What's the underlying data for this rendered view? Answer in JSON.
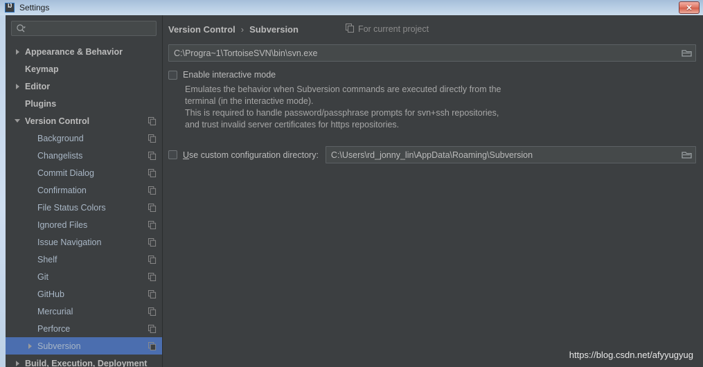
{
  "window": {
    "title": "Settings",
    "app_icon": "intellij-idea-icon",
    "close_label": "✕",
    "accent_selection": "#4b6eaf",
    "background": "#3c3f41",
    "titlebar_color": "#b7cde4"
  },
  "sidebar": {
    "search": {
      "placeholder": "",
      "value": "",
      "icon": "search-icon"
    },
    "items": [
      {
        "label": "Appearance & Behavior",
        "level": 0,
        "arrow": "right",
        "bold": true,
        "project_icon": false,
        "selected": false
      },
      {
        "label": "Keymap",
        "level": 0,
        "arrow": "none",
        "bold": true,
        "project_icon": false,
        "selected": false
      },
      {
        "label": "Editor",
        "level": 0,
        "arrow": "right",
        "bold": true,
        "project_icon": false,
        "selected": false
      },
      {
        "label": "Plugins",
        "level": 0,
        "arrow": "none",
        "bold": true,
        "project_icon": false,
        "selected": false
      },
      {
        "label": "Version Control",
        "level": 0,
        "arrow": "down",
        "bold": true,
        "project_icon": true,
        "selected": false
      },
      {
        "label": "Background",
        "level": 1,
        "arrow": "none",
        "bold": false,
        "project_icon": true,
        "selected": false
      },
      {
        "label": "Changelists",
        "level": 1,
        "arrow": "none",
        "bold": false,
        "project_icon": true,
        "selected": false
      },
      {
        "label": "Commit Dialog",
        "level": 1,
        "arrow": "none",
        "bold": false,
        "project_icon": true,
        "selected": false
      },
      {
        "label": "Confirmation",
        "level": 1,
        "arrow": "none",
        "bold": false,
        "project_icon": true,
        "selected": false
      },
      {
        "label": "File Status Colors",
        "level": 1,
        "arrow": "none",
        "bold": false,
        "project_icon": true,
        "selected": false
      },
      {
        "label": "Ignored Files",
        "level": 1,
        "arrow": "none",
        "bold": false,
        "project_icon": true,
        "selected": false
      },
      {
        "label": "Issue Navigation",
        "level": 1,
        "arrow": "none",
        "bold": false,
        "project_icon": true,
        "selected": false
      },
      {
        "label": "Shelf",
        "level": 1,
        "arrow": "none",
        "bold": false,
        "project_icon": true,
        "selected": false
      },
      {
        "label": "Git",
        "level": 1,
        "arrow": "none",
        "bold": false,
        "project_icon": true,
        "selected": false
      },
      {
        "label": "GitHub",
        "level": 1,
        "arrow": "none",
        "bold": false,
        "project_icon": true,
        "selected": false
      },
      {
        "label": "Mercurial",
        "level": 1,
        "arrow": "none",
        "bold": false,
        "project_icon": true,
        "selected": false
      },
      {
        "label": "Perforce",
        "level": 1,
        "arrow": "none",
        "bold": false,
        "project_icon": true,
        "selected": false
      },
      {
        "label": "Subversion",
        "level": 1,
        "arrow": "right",
        "bold": false,
        "project_icon": true,
        "selected": true
      },
      {
        "label": "Build, Execution, Deployment",
        "level": 0,
        "arrow": "right",
        "bold": true,
        "project_icon": false,
        "selected": false
      }
    ]
  },
  "main": {
    "breadcrumb": {
      "parent": "Version Control",
      "separator": "›",
      "current": "Subversion"
    },
    "scope": {
      "icon": "project-scope-icon",
      "label": "For current project"
    },
    "svn_path": {
      "value": "C:\\Progra~1\\TortoiseSVN\\bin\\svn.exe",
      "placeholder": "",
      "browse_icon": "folder-icon"
    },
    "interactive_mode": {
      "label": "Enable interactive mode",
      "checked": false,
      "description_lines": [
        "Emulates the behavior when Subversion commands are executed directly from the",
        "terminal (in the interactive mode).",
        "This is required to handle password/passphrase prompts for svn+ssh repositories,",
        "and trust invalid server certificates for https repositories."
      ]
    },
    "custom_config": {
      "label_mnemonic": "U",
      "label_rest": "se custom configuration directory:",
      "checked": false,
      "value": "C:\\Users\\rd_jonny_lin\\AppData\\Roaming\\Subversion",
      "placeholder": "",
      "browse_icon": "folder-icon"
    }
  },
  "watermark": {
    "text": "https://blog.csdn.net/afyyugyug"
  }
}
